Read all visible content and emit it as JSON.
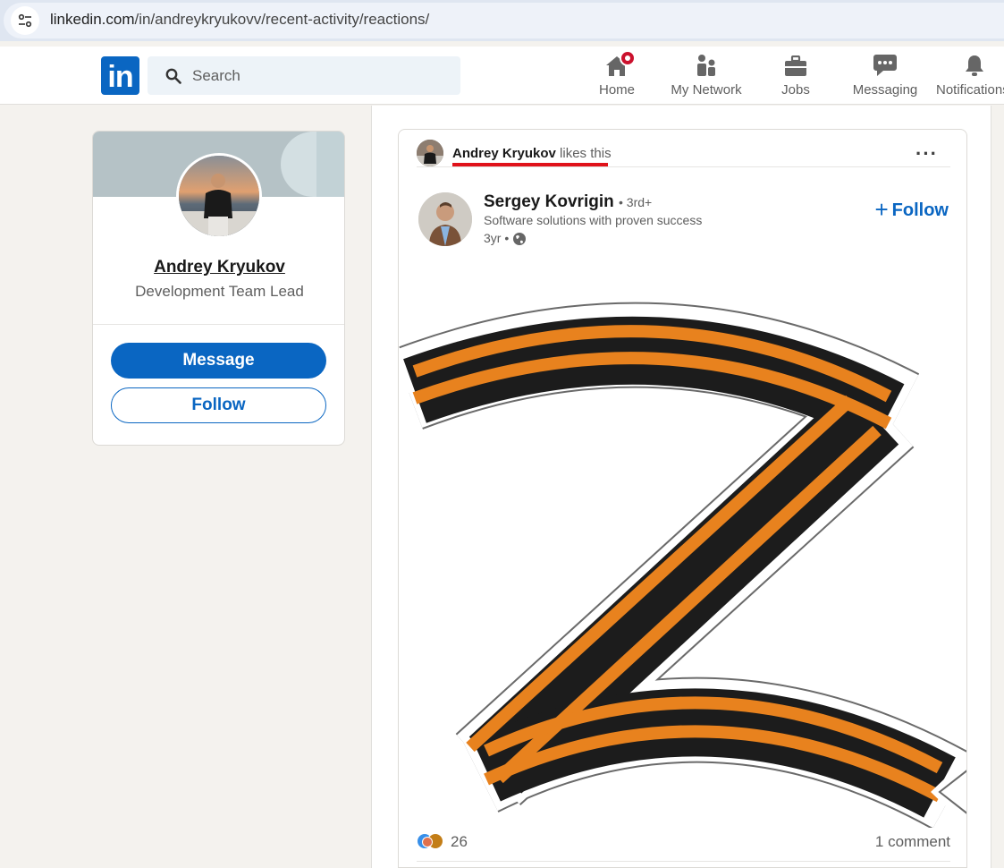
{
  "browser": {
    "url_host": "linkedin.com",
    "url_path": "/in/andreykryukovv/recent-activity/reactions/"
  },
  "topnav": {
    "logo_text": "in",
    "search_placeholder": "Search",
    "items": [
      {
        "label": "Home",
        "icon": "home-icon",
        "has_badge": true
      },
      {
        "label": "My Network",
        "icon": "network-icon"
      },
      {
        "label": "Jobs",
        "icon": "briefcase-icon"
      },
      {
        "label": "Messaging",
        "icon": "messaging-icon"
      },
      {
        "label": "Notifications",
        "icon": "bell-icon"
      }
    ],
    "colors": {
      "brand": "#0a66c2",
      "badge": "#cb112d"
    }
  },
  "profile": {
    "name": "Andrey Kryukov",
    "title": "Development Team Lead",
    "message_label": "Message",
    "follow_label": "Follow"
  },
  "post": {
    "activity_actor": "Andrey Kryukov",
    "activity_verb": "likes this",
    "more_label": "···",
    "author_name": "Sergey Kovrigin",
    "author_degree": "• 3rd+",
    "author_headline": "Software solutions with proven success",
    "author_time": "3yr •",
    "follow_label": "Follow",
    "image_content": "Z symbol in orange and black St. George ribbon stripes",
    "reaction_count": "26",
    "comment_count": "1 comment",
    "colors": {
      "ribbon_orange": "#e8821e",
      "ribbon_black": "#1c1c1c",
      "highlight_red": "#e0121a"
    }
  }
}
